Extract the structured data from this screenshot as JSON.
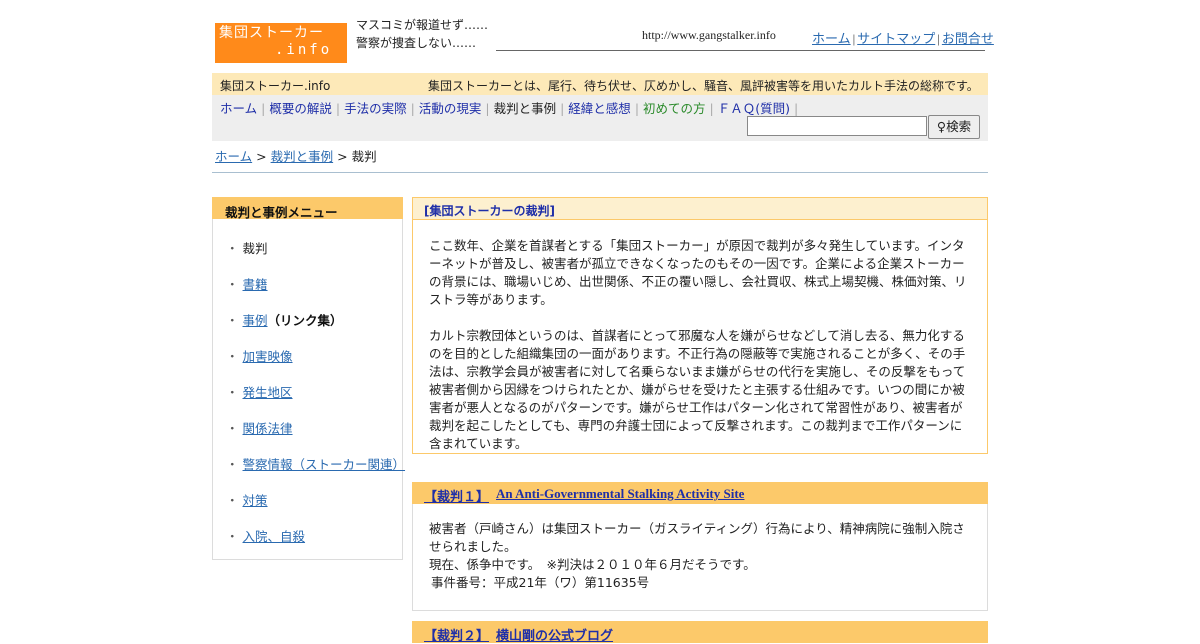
{
  "header": {
    "logo_line1": "集団ストーカー",
    "logo_line2": ".info",
    "tagline": "マスコミが報道せず……　警察が捜査しない……",
    "url": "http://www.gangstalker.info",
    "links": [
      "ホーム",
      "サイトマップ",
      "お問合せ"
    ]
  },
  "bar": {
    "site_name": "集団ストーカー.info",
    "description": "集団ストーカーとは、尾行、待ち伏せ、仄めかし、騒音、風評被害等を用いたカルト手法の総称です。"
  },
  "nav": {
    "items": [
      "ホーム",
      "概要の解説",
      "手法の実際",
      "活動の現実",
      "裁判と事例",
      "経緯と感想",
      "初めての方",
      "ＦＡＱ(質問)"
    ],
    "search_placeholder": "",
    "search_button": "♀検索"
  },
  "breadcrumb": {
    "home": "ホーム",
    "parent": "裁判と事例",
    "current": "裁判",
    "sep": ">"
  },
  "sidebar": {
    "title": "裁判と事例メニュー",
    "bullet": "・",
    "items": [
      {
        "label": "裁判",
        "suffix": ""
      },
      {
        "label": "書籍",
        "suffix": ""
      },
      {
        "label": "事例",
        "suffix": "（リンク集）"
      },
      {
        "label": "加害映像",
        "suffix": ""
      },
      {
        "label": "発生地区",
        "suffix": ""
      },
      {
        "label": "関係法律",
        "suffix": ""
      },
      {
        "label": "警察情報（ストーカー関連）",
        "suffix": ""
      },
      {
        "label": "対策",
        "suffix": ""
      },
      {
        "label": "入院、自殺",
        "suffix": ""
      }
    ]
  },
  "main": {
    "title": "[集団ストーカーの裁判]",
    "para1": "ここ数年、企業を首謀者とする「集団ストーカー」が原因で裁判が多々発生しています。インターネットが普及し、被害者が孤立できなくなったのもその一因です。企業による企業ストーカーの背景には、職場いじめ、出世関係、不正の覆い隠し、会社買収、株式上場契機、株価対策、リストラ等があります。",
    "para2": "カルト宗教団体というのは、首謀者にとって邪魔な人を嫌がらせなどして消し去る、無力化するのを目的とした組織集団の一面があります。不正行為の隠蔽等で実施されることが多く、その手法は、宗教学会員が被害者に対して名乗らないまま嫌がらせの代行を実施し、その反撃をもって被害者側から因縁をつけられたとか、嫌がらせを受けたと主張する仕組みです。いつの間にか被害者が悪人となるのがパターンです。嫌がらせ工作はパターン化されて常習性があり、被害者が裁判を起こしたとしても、専門の弁護士団によって反撃されます。この裁判まで工作パターンに含まれています。"
  },
  "cases": [
    {
      "label": "【裁判１】",
      "link": "An Anti-Governmental Stalking Activity Site",
      "lines": [
        "被害者（戸崎さん）は集団ストーカー（ガスライティング）行為により、精神病院に強制入院させられました。",
        "現在、係争中です。　※判決は２０１０年６月だそうです。",
        "事件番号：平成21年（ワ）第11635号"
      ]
    },
    {
      "label": "【裁判２】",
      "link": "横山剛の公式ブログ"
    }
  ]
}
